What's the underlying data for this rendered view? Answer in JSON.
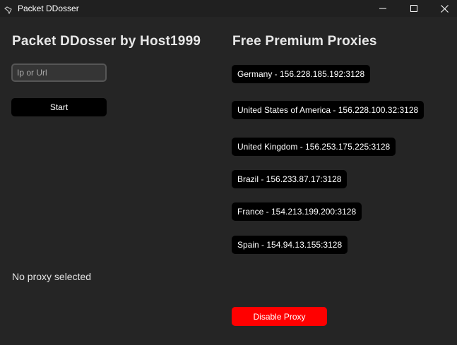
{
  "window": {
    "title": "Packet DDosser",
    "icon": "app-icon"
  },
  "left": {
    "heading": "Packet DDosser by Host1999",
    "input_placeholder": "Ip or Url",
    "input_value": "",
    "start_label": "Start",
    "status": "No proxy selected"
  },
  "right": {
    "heading": "Free Premium Proxies",
    "proxies": [
      "Germany - 156.228.185.192:3128",
      "United States of America - 156.228.100.32:3128",
      "United Kingdom - 156.253.175.225:3128",
      "Brazil - 156.233.87.17:3128",
      "France - 154.213.199.200:3128",
      "Spain - 154.94.13.155:3128"
    ],
    "disable_label": "Disable Proxy"
  },
  "colors": {
    "background": "#252525",
    "titlebar": "#202020",
    "button": "#000000",
    "disable_button": "#ff0000",
    "input_background": "#353535",
    "input_border": "#565656"
  }
}
